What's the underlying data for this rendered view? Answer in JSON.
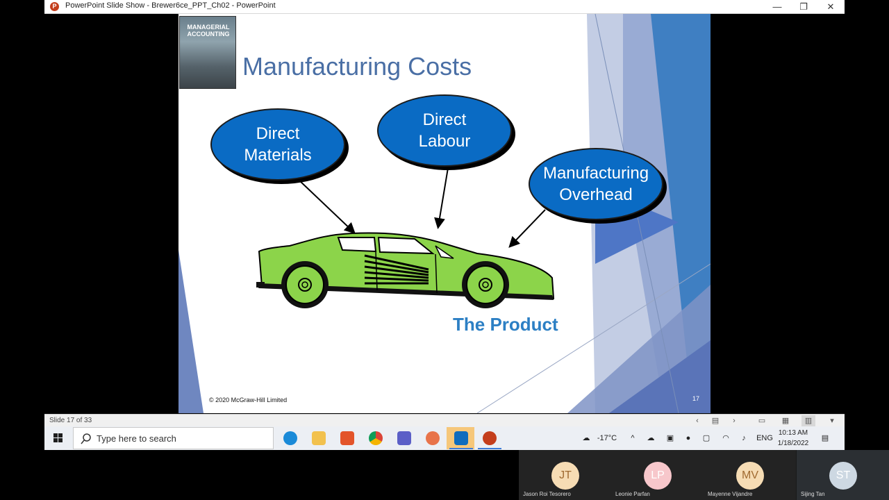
{
  "window": {
    "title": "PowerPoint Slide Show  -  Brewer6ce_PPT_Ch02 - PowerPoint",
    "app_icon_letter": "P",
    "minimize": "—",
    "restore": "❐",
    "close": "✕"
  },
  "slide": {
    "book_title": "MANAGERIAL\nACCOUNTING",
    "title": "Manufacturing Costs",
    "ovals": {
      "direct_materials": "Direct\nMaterials",
      "direct_labour": "Direct\nLabour",
      "manufacturing_overhead": "Manufacturing\nOverhead"
    },
    "product_label": "The Product",
    "copyright": "© 2020 McGraw-Hill Limited",
    "slide_number": "17",
    "colors": {
      "oval_fill": "#0a6bc4",
      "car_body": "#8cd44a",
      "title_color": "#4a6fa5",
      "product_label": "#2c7fc4"
    }
  },
  "statusbar": {
    "slide_counter": "Slide 17 of 33",
    "icons": [
      "chevron-left-icon",
      "notes-icon",
      "chevron-right-icon",
      "normal-view-icon",
      "slide-sorter-icon",
      "reading-view-icon",
      "slideshow-icon"
    ]
  },
  "taskbar": {
    "search_placeholder": "Type here to search",
    "apps": [
      "edge-icon",
      "file-explorer-icon",
      "office-icon",
      "chrome-icon",
      "teams-icon",
      "snipping-tool-icon",
      "outlook-icon",
      "powerpoint-icon"
    ],
    "weather": "-17°C",
    "language": "ENG",
    "time": "10:13 AM",
    "date": "1/18/2022"
  },
  "participants": [
    {
      "initials": "JT",
      "name": "Jason Roi  Tesorero",
      "color": "#f6dcb4",
      "text_color": "#a06a30"
    },
    {
      "initials": "LP",
      "name": "Leonie Parfan",
      "color": "#f7c7cb",
      "text_color": "#ffffff"
    },
    {
      "initials": "MV",
      "name": "Mayenne Vijandre",
      "color": "#f6dcb4",
      "text_color": "#a06a30"
    },
    {
      "initials": "ST",
      "name": "Sijing Tan",
      "color": "#cdd8e2",
      "text_color": "#ffffff"
    }
  ]
}
